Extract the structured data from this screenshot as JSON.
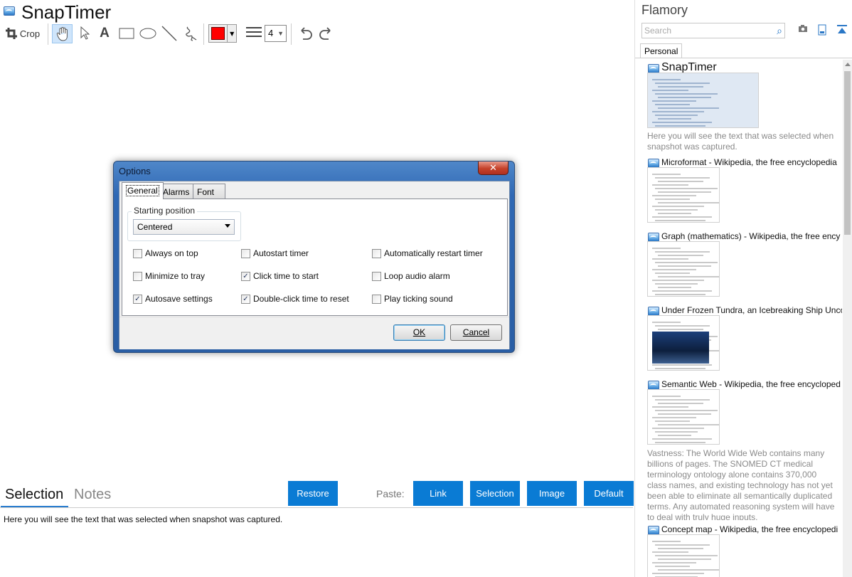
{
  "app": {
    "title": "SnapTimer"
  },
  "toolbar": {
    "crop_label": "Crop",
    "tools": [
      "crop-icon",
      "hand-icon",
      "arrow-select-icon",
      "text-icon",
      "rectangle-icon",
      "ellipse-icon",
      "line-icon",
      "freehand-icon"
    ],
    "color": "#ff0000",
    "stroke_size": "4",
    "undo_icon": "undo-icon",
    "redo_icon": "redo-icon"
  },
  "dialog": {
    "title": "Options",
    "close_glyph": "✕",
    "tabs": [
      "General",
      "Alarms",
      "Font"
    ],
    "starting_position_label": "Starting position",
    "starting_position_value": "Centered",
    "checkboxes": [
      {
        "label": "Always on top",
        "checked": false
      },
      {
        "label": "Minimize to tray",
        "checked": false
      },
      {
        "label": "Autosave settings",
        "checked": true
      },
      {
        "label": "Autostart timer",
        "checked": false
      },
      {
        "label": "Click time to start",
        "checked": true
      },
      {
        "label": "Double-click time to reset",
        "checked": true
      },
      {
        "label": "Automatically restart timer",
        "checked": false
      },
      {
        "label": "Loop audio alarm",
        "checked": false
      },
      {
        "label": "Play ticking sound",
        "checked": false
      }
    ],
    "ok_label": "OK",
    "cancel_label": "Cancel"
  },
  "bottom": {
    "tabs": [
      "Selection",
      "Notes"
    ],
    "restore_label": "Restore",
    "paste_label": "Paste:",
    "paste_buttons": [
      "Link",
      "Selection",
      "Image",
      "Default"
    ],
    "selection_text": "Here you will see the text that was selected when snapshot was captured."
  },
  "right_pane": {
    "title": "Flamory",
    "search_placeholder": "Search",
    "tab": "Personal",
    "items": [
      {
        "title": "SnapTimer",
        "desc": "Here you will see the text that was selected when snapshot was captured."
      },
      {
        "title": "Microformat - Wikipedia, the free encyclopedia",
        "desc": ""
      },
      {
        "title": "Graph (mathematics) - Wikipedia, the free ency",
        "desc": ""
      },
      {
        "title": "Under Frozen Tundra, an Icebreaking Ship Unco",
        "desc": ""
      },
      {
        "title": "Semantic Web - Wikipedia, the free encycloped",
        "desc": "Vastness: The World Wide Web contains many billions of pages. The SNOMED CT medical terminology ontology alone contains 370,000 class names, and existing technology has not yet been able to eliminate all semantically duplicated terms. Any automated reasoning system will have to deal with truly huge inputs."
      },
      {
        "title": "Concept map - Wikipedia, the free encyclopedi",
        "desc": ""
      }
    ]
  }
}
